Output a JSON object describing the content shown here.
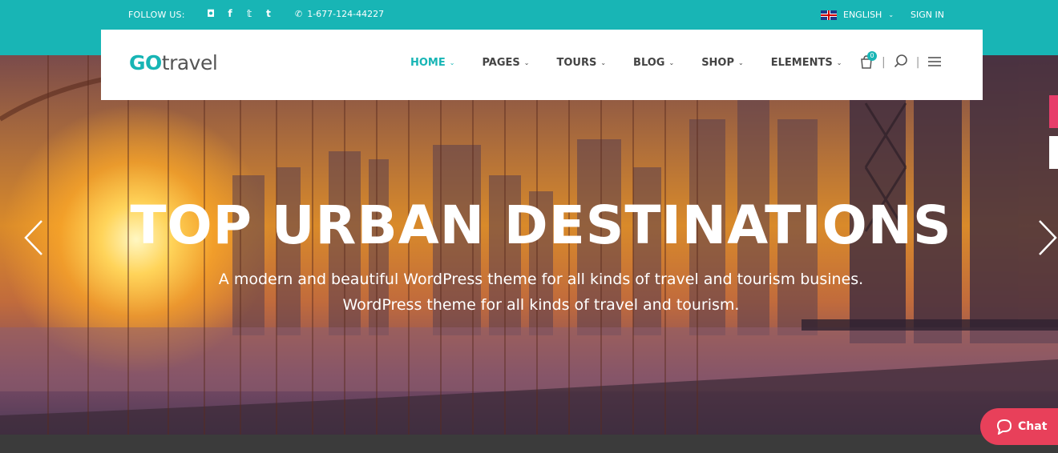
{
  "topbar": {
    "follow_label": "FOLLOW US:",
    "social_icons": [
      "instagram-icon",
      "facebook-icon",
      "twitter-icon",
      "tumblr-icon"
    ],
    "phone": "1-677-124-44227",
    "language": "ENGLISH",
    "signin": "SIGN IN"
  },
  "logo": {
    "part1": "GO",
    "part2": "travel"
  },
  "nav": {
    "items": [
      {
        "label": "HOME",
        "active": true
      },
      {
        "label": "PAGES"
      },
      {
        "label": "TOURS"
      },
      {
        "label": "BLOG"
      },
      {
        "label": "SHOP"
      },
      {
        "label": "ELEMENTS"
      }
    ],
    "cart_count": "0"
  },
  "hero": {
    "title": "TOP URBAN DESTINATIONS",
    "subtitle_line1": "A modern and beautiful WordPress theme for all kinds of travel and tourism busines.",
    "subtitle_line2": "WordPress theme for all kinds of travel and tourism."
  },
  "chat": {
    "label": "Chat"
  },
  "colors": {
    "accent": "#18b5b5",
    "chat": "#e8405a"
  }
}
